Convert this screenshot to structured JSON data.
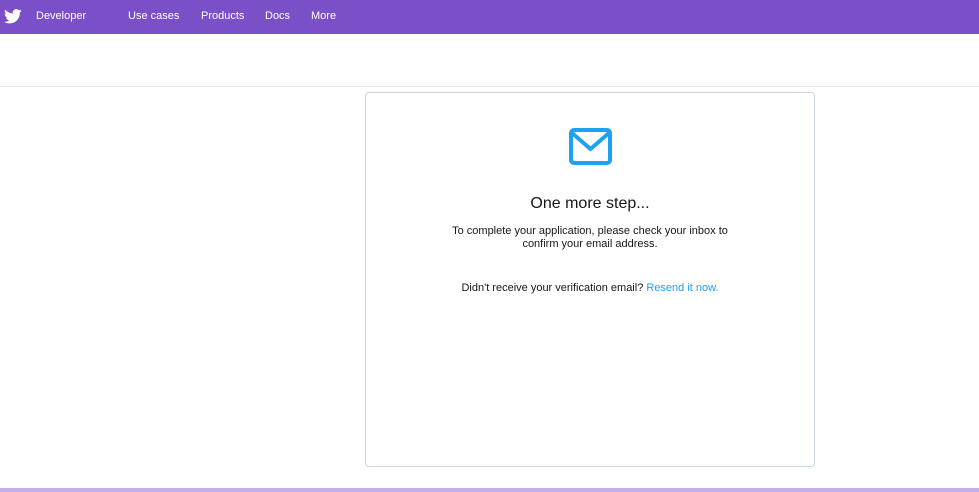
{
  "topnav": {
    "brand": "Developer",
    "links": [
      {
        "label": "Use cases"
      },
      {
        "label": "Products"
      },
      {
        "label": "Docs"
      },
      {
        "label": "More"
      }
    ],
    "colors": {
      "background": "#7b4fc8",
      "text": "#ffffff"
    },
    "icon": "twitter-bird-icon"
  },
  "card": {
    "icon": "envelope-icon",
    "title": "One more step...",
    "body": "To complete your application, please check your inbox to confirm your email address.",
    "resend_prompt": "Didn't receive your verification email?",
    "resend_link": "Resend it now.",
    "colors": {
      "accent": "#1da1f2",
      "border": "#ccd6dd"
    }
  }
}
